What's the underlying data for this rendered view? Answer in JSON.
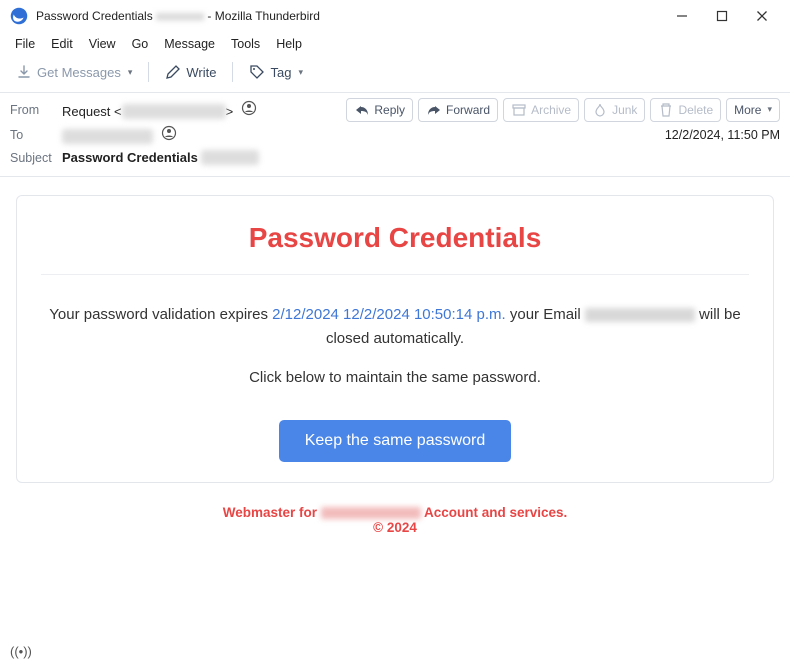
{
  "window": {
    "title_prefix": "Password Credentials",
    "title_suffix": " - Mozilla Thunderbird"
  },
  "menubar": [
    "File",
    "Edit",
    "View",
    "Go",
    "Message",
    "Tools",
    "Help"
  ],
  "toolbar": {
    "get_messages": "Get Messages",
    "write": "Write",
    "tag": "Tag"
  },
  "headers": {
    "from_label": "From",
    "from_value": "Request <",
    "from_suffix": ">",
    "to_label": "To",
    "subject_label": "Subject",
    "subject_value": "Password Credentials",
    "timestamp": "12/2/2024, 11:50 PM"
  },
  "header_buttons": {
    "reply": "Reply",
    "forward": "Forward",
    "archive": "Archive",
    "junk": "Junk",
    "delete": "Delete",
    "more": "More"
  },
  "email": {
    "title": "Password Credentials",
    "line1_pre": "Your password validation expires ",
    "line1_date": "2/12/2024 12/2/2024 10:50:14 p.m.",
    "line1_mid": " your Email ",
    "line1_post": " will be closed automatically.",
    "line2": "Click below to maintain the same password.",
    "cta": "Keep the same password",
    "footer_pre": "Webmaster for ",
    "footer_post": " Account and services.",
    "copyright": "© 2024"
  }
}
